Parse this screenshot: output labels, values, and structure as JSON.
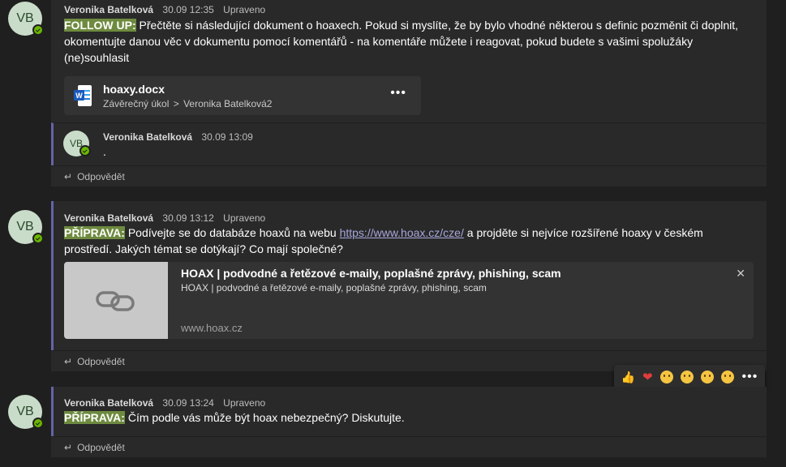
{
  "messages": [
    {
      "avatar": "VB",
      "author": "Veronika Batelková",
      "time": "30.09 12:35",
      "edited": "Upraveno",
      "tag": "FOLLOW UP:",
      "text": " Přečtěte si následující dokument o hoaxech. Pokud si myslíte, že by bylo vhodné některou s definic pozměnit či doplnit, okomentujte danou věc v dokumentu pomocí komentářů - na komentáře můžete i reagovat, pokud budete s vašimi spolužáky (ne)souhlasit",
      "file": {
        "name": "hoaxy.docx",
        "path_part1": "Závěrečný úkol",
        "path_sep": ">",
        "path_part2": "Veronika Batelková2",
        "more": "•••"
      },
      "reply": {
        "avatar": "VB",
        "author": "Veronika Batelková",
        "time": "30.09 13:09",
        "text": "."
      },
      "reply_label": "Odpovědět"
    },
    {
      "avatar": "VB",
      "author": "Veronika Batelková",
      "time": "30.09 13:12",
      "edited": "Upraveno",
      "tag": "PŘÍPRAVA:",
      "text_before_link": " Podívejte se do databáze hoaxů na webu ",
      "link": "https://www.hoax.cz/cze/",
      "text_after_link": " a projděte si nejvíce rozšířené hoaxy v českém prostředí. Jakých témat se dotýkají? Co mají společné?",
      "preview": {
        "title": "HOAX | podvodné a řetězové e-maily, poplašné zprávy, phishing, scam",
        "description": "HOAX | podvodné a řetězové e-maily, poplašné zprávy, phishing, scam",
        "domain": "www.hoax.cz",
        "close": "✕"
      },
      "reply_label": "Odpovědět"
    },
    {
      "avatar": "VB",
      "author": "Veronika Batelková",
      "time": "30.09 13:24",
      "edited": "Upraveno",
      "tag": "PŘÍPRAVA:",
      "text": " Čím podle vás může být hoax nebezpečný? Diskutujte.",
      "reply_label": "Odpovědět"
    }
  ],
  "reactions": [
    "like",
    "heart",
    "laugh",
    "surprised",
    "sad",
    "angry"
  ],
  "reactions_more": "•••",
  "colors": {
    "accent": "#6264a7",
    "highlight": "#6e8a3f",
    "presence": "#6bb700"
  }
}
